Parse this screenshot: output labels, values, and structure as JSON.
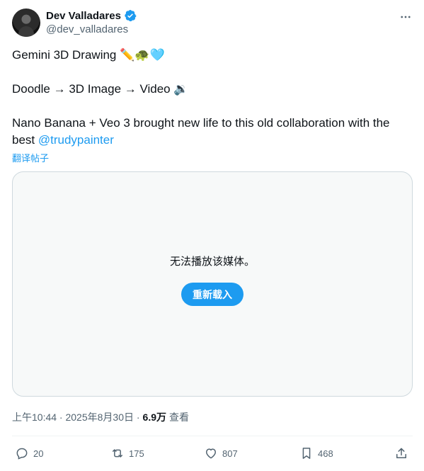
{
  "author": {
    "display_name": "Dev Valladares",
    "handle": "@dev_valladares",
    "verified": true
  },
  "post": {
    "line1": "Gemini 3D Drawing ✏️🐢🩵",
    "line2": "Doodle → 3D Image → Video 🔉",
    "line3_text": "Nano Banana + Veo 3 brought new life to this old collaboration with the best ",
    "mention": "@trudypainter",
    "translate_label": "翻译帖子"
  },
  "media": {
    "message": "无法播放该媒体。",
    "reload_label": "重新载入"
  },
  "meta": {
    "timestamp": "上午10:44 · 2025年8月30日 ·",
    "views_count": "6.9万",
    "views_label": "查看"
  },
  "actions": {
    "replies": "20",
    "reposts": "175",
    "likes": "807",
    "bookmarks": "468"
  },
  "colors": {
    "accent": "#1d9bf0",
    "secondary_text": "#536471",
    "border": "#cfd9de"
  }
}
